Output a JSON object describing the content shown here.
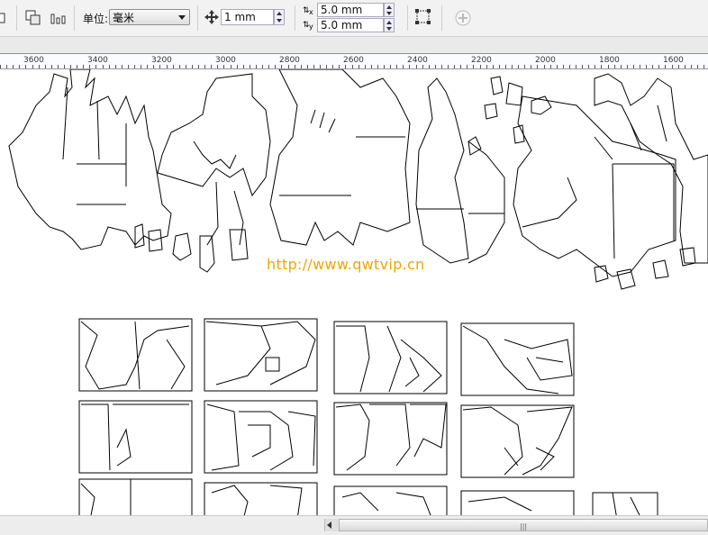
{
  "toolbar": {
    "units_label": "单位:",
    "units_value": "毫米",
    "nudge_value": "1 mm",
    "dup_x": "5.0 mm",
    "dup_y": "5.0 mm"
  },
  "ruler": {
    "labels": [
      "3600",
      "3400",
      "3200",
      "3000",
      "2800",
      "2600",
      "2400",
      "2200",
      "2000",
      "1800",
      "1600"
    ]
  },
  "canvas": {
    "watermark": "http://www.qwtvip.cn"
  },
  "colors": {
    "ruler_accent": "#4aa3d9",
    "watermark": "#f0a500"
  }
}
